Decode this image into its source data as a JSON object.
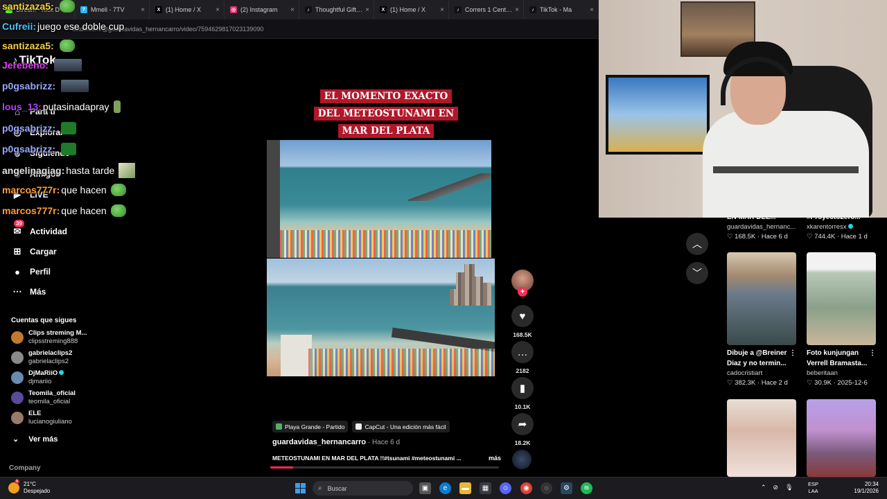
{
  "browser": {
    "tabs": [
      {
        "label": "Stream - Kick D",
        "color": "#53fc18",
        "glyph": "K"
      },
      {
        "label": "Mmeli - 7TV",
        "color": "#29b6f6",
        "glyph": "7"
      },
      {
        "label": "(1) Home / X",
        "color": "#000000",
        "glyph": "X"
      },
      {
        "label": "(2) Instagram",
        "color": "#e1306c",
        "glyph": "◎"
      },
      {
        "label": "Thoughtful Gift id",
        "color": "#111111",
        "glyph": "♪"
      },
      {
        "label": "(1) Home / X",
        "color": "#000000",
        "glyph": "X"
      },
      {
        "label": "Corrers 1 Centím",
        "color": "#111111",
        "glyph": "♪"
      },
      {
        "label": "TikTok - Ma",
        "color": "#111111",
        "glyph": "♪"
      }
    ],
    "url": "tiktok.com/@guardavidas_hernancarro/video/7594629817023139090"
  },
  "sidebar": {
    "logo": "TikTok",
    "nav": [
      {
        "label": "Para ti",
        "icon": "home-icon"
      },
      {
        "label": "Explorar",
        "icon": "compass-icon"
      },
      {
        "label": "Siguiendo",
        "icon": "following-icon"
      },
      {
        "label": "Amigos",
        "icon": "friends-icon"
      },
      {
        "label": "LIVE",
        "icon": "live-icon"
      },
      {
        "label": "Actividad",
        "icon": "inbox-icon",
        "badge": "39"
      },
      {
        "label": "Cargar",
        "icon": "upload-icon"
      },
      {
        "label": "Perfil",
        "icon": "profile-icon"
      },
      {
        "label": "Más",
        "icon": "more-icon"
      }
    ],
    "following_header": "Cuentas que sigues",
    "following": [
      {
        "name": "Clips streming M...",
        "handle": "clipsstreming888",
        "color": "#c07a30"
      },
      {
        "name": "gabrielaclips2",
        "handle": "gabrielaclips2",
        "color": "#8a8a8a"
      },
      {
        "name": "DjMaRiiO",
        "handle": "djmariio",
        "color": "#6a8ab0",
        "verified": true
      },
      {
        "name": "Teomila_oficial",
        "handle": "teomila_oficial",
        "color": "#5a4a9a"
      },
      {
        "name": "ELE",
        "handle": "lucianogiuliano",
        "color": "#9a7a6a"
      }
    ],
    "see_more": "Ver más",
    "company": "Company"
  },
  "chat": [
    {
      "user": "santizaza5:",
      "color": "#f5d142",
      "text": "",
      "emote": "frog"
    },
    {
      "user": "Cufreii:",
      "color": "#4fc3f7",
      "text": " juego ese doble cup",
      "emote": ""
    },
    {
      "user": "santizaza5:",
      "color": "#f5d142",
      "text": "",
      "emote": "frog"
    },
    {
      "user": "Jerebeno:",
      "color": "#e040fb",
      "text": "",
      "emote": "face"
    },
    {
      "user": "p0gsabrizz:",
      "color": "#9aa6ff",
      "text": "",
      "emote": "face"
    },
    {
      "user": "lous_13:",
      "color": "#b040ff",
      "text": " putasinadapray",
      "emote": "walk"
    },
    {
      "user": "p0gsabrizz:",
      "color": "#9aa6ff",
      "text": "",
      "emote": "green"
    },
    {
      "user": "p0gsabrizz:",
      "color": "#9aa6ff",
      "text": "",
      "emote": "green"
    },
    {
      "user": "angelinagiag:",
      "color": "#e0e0e0",
      "text": " hasta tarde",
      "emote": "pic"
    },
    {
      "user": "marcos777r:",
      "color": "#ff9d3b",
      "text": " que hacen",
      "emote": "frog"
    },
    {
      "user": "marcos777r:",
      "color": "#ff9d3b",
      "text": " que hacen",
      "emote": "frog"
    }
  ],
  "video": {
    "title_lines": [
      "EL MOMENTO EXACTO",
      "DEL METEOSTUNAMI EN",
      "MAR DEL PLATA"
    ],
    "likes": "168.5K",
    "comments": "2182",
    "saves": "10.1K",
    "shares": "18.2K",
    "chip1": "Playa Grande - Partido",
    "chip2": "CapCut - Una edición más fácil",
    "author": "guardavidas_hernancarro",
    "ago": " · Hace 6 d",
    "desc": "METEOSTUNAMI EN MAR DEL PLATA !!#tsunami #meteostunami ...",
    "more": "más",
    "progress": 0.1
  },
  "grid": [
    {
      "title": "EN MAR DEL...",
      "author": "guardavidas_hernanc...",
      "stats": "♡ 168.5K · Hace 6 d",
      "thumb": "none"
    },
    {
      "title": "#Proyecto2ero...",
      "author": "xkarentorresx",
      "verified": true,
      "stats": "♡ 744.4K · Hace 1 d",
      "thumb": "none"
    },
    {
      "title": "Dibuje a @Breiner Diaz y no termin...",
      "author": "cadocristiart",
      "stats": "♡ 382.3K · Hace 2 d",
      "thumb": "t-man"
    },
    {
      "title": "Foto kunjungan Verrell Bramasta...",
      "author": "beberitaan",
      "stats": "♡ 30.9K · 2025-12-6",
      "thumb": "t-tree"
    },
    {
      "title": "",
      "author": "",
      "stats": "",
      "thumb": "t-girl"
    },
    {
      "title": "",
      "author": "",
      "stats": "",
      "thumb": "t-game"
    }
  ],
  "taskbar": {
    "temp": "21°C",
    "weather": "Despejado",
    "weather_badge": "6",
    "search_placeholder": "Buscar",
    "lang1": "ESP",
    "lang2": "LAA",
    "time": "20:34",
    "date": "19/1/2026"
  }
}
